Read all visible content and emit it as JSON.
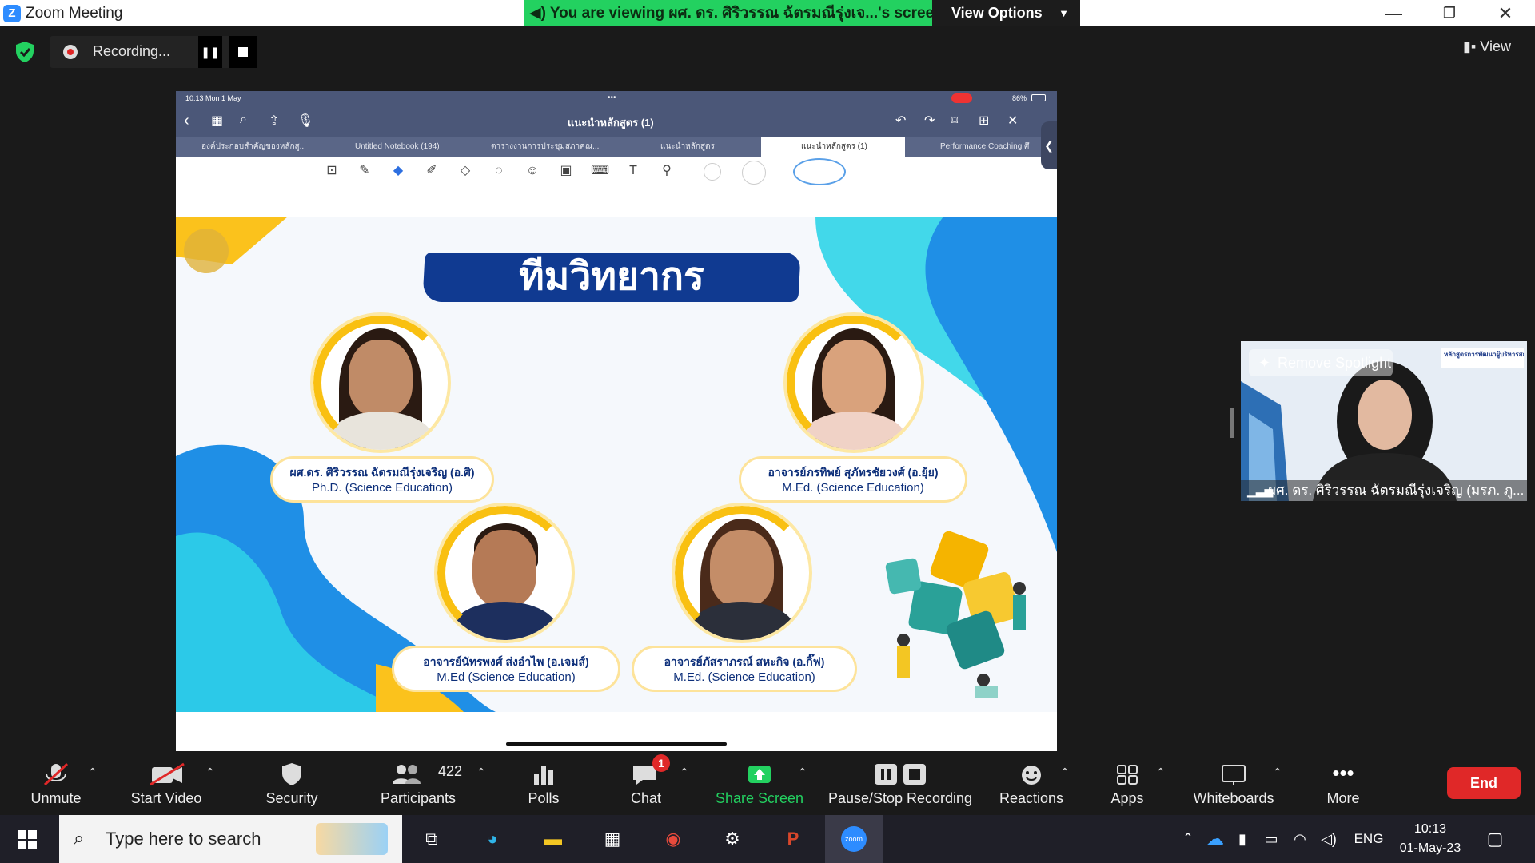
{
  "window": {
    "app_icon": "zoom-logo",
    "title": "Zoom Meeting",
    "minimize": "—",
    "restore": "❐",
    "close": "✕"
  },
  "banner": {
    "viewing_text": "You are viewing ผศ. ดร. ศิริวรรณ ฉัตรมณีรุ่งเจ...'s screen",
    "view_options_label": "View Options"
  },
  "recording": {
    "label": "Recording...",
    "pause_icon": "pause-icon",
    "stop_icon": "stop-icon"
  },
  "top_right": {
    "view_label": "View"
  },
  "ipad": {
    "status_time": "10:13  Mon 1 May",
    "battery": "86%",
    "doc_title": "แนะนำหลักสูตร (1)",
    "tabs": [
      {
        "label": "องค์ประกอบสำคัญของหลักสู..."
      },
      {
        "label": "Untitled Notebook (194)"
      },
      {
        "label": "ตารางงานการประชุมสภาคณ..."
      },
      {
        "label": "แนะนำหลักสูตร"
      },
      {
        "label": "แนะนำหลักสูตร (1)",
        "active": true
      },
      {
        "label": "Performance Coaching ศึ"
      }
    ]
  },
  "slide": {
    "title": "ทีมวิทยากร",
    "speakers": [
      {
        "name": "ผศ.ดร. ศิริวรรณ ฉัตรมณีรุ่งเจริญ (อ.ศิ)",
        "degree": "Ph.D. (Science Education)"
      },
      {
        "name": "อาจารย์ภรทิพย์ สุภัทรชัยวงศ์ (อ.ยุ้ย)",
        "degree": "M.Ed. (Science Education)"
      },
      {
        "name": "อาจารย์นัทรพงศ์ ส่งอำไพ (อ.เจมส์)",
        "degree": "M.Ed (Science Education)"
      },
      {
        "name": "อาจารย์ภัสราภรณ์ สหะกิจ (อ.กิ๊ฟ)",
        "degree": "M.Ed. (Science Education)"
      }
    ]
  },
  "video_tile": {
    "remove_spotlight": "Remove Spotlight",
    "participant_name": "ผศ. ดร. ศิริวรรณ ฉัตรมณีรุ่งเจริญ (มรภ. ภู...",
    "banner_text": "หลักสูตรการพัฒนาผู้บริหารสถานศึกษา"
  },
  "toolbar": {
    "unmute": "Unmute",
    "start_video": "Start Video",
    "security": "Security",
    "participants": "Participants",
    "participants_count": "422",
    "polls": "Polls",
    "chat": "Chat",
    "chat_badge": "1",
    "share_screen": "Share Screen",
    "pause_stop_recording": "Pause/Stop Recording",
    "reactions": "Reactions",
    "apps": "Apps",
    "whiteboards": "Whiteboards",
    "more": "More",
    "end": "End",
    "share_color": "#23d160",
    "end_color": "#e02828"
  },
  "taskbar": {
    "search_placeholder": "Type here to search",
    "language": "ENG",
    "time": "10:13",
    "date": "01-May-23"
  }
}
